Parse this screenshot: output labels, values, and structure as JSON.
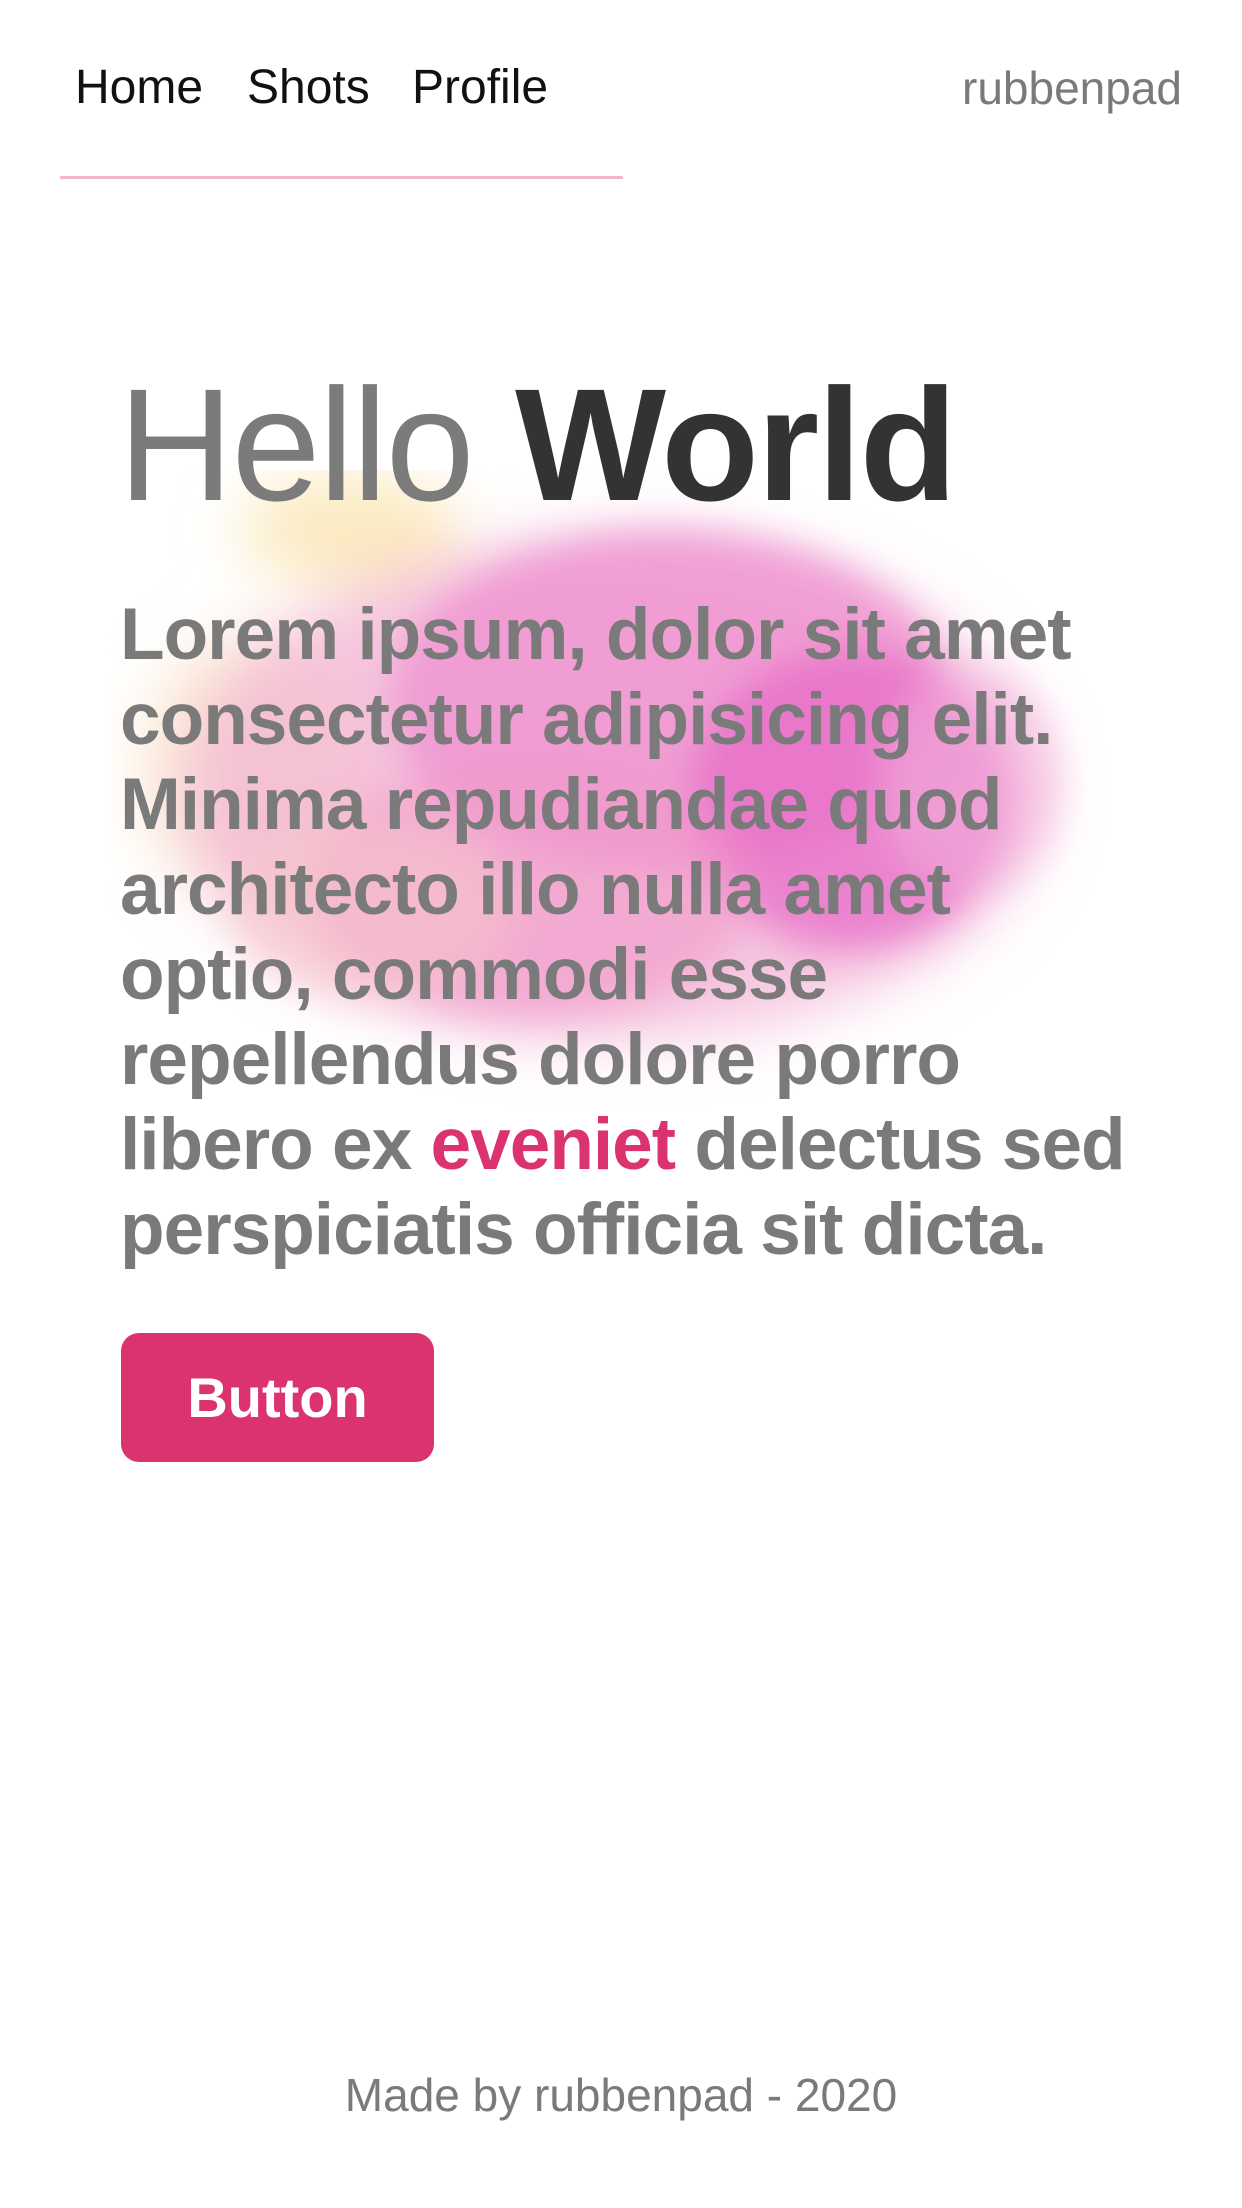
{
  "nav": {
    "links": [
      {
        "label": "Home"
      },
      {
        "label": "Shots"
      },
      {
        "label": "Profile"
      }
    ],
    "username": "rubbenpad",
    "accent_color": "#f0b6c9"
  },
  "hero": {
    "title_light": "Hello",
    "title_bold": "World",
    "paragraph_before": "Lorem ipsum, dolor sit amet consectetur adipisicing elit. Minima repudiandae quod architecto illo nulla amet optio, commodi esse repellendus dolore porro libero ex ",
    "paragraph_highlight": "eveniet",
    "paragraph_after": " delectus sed perspiciatis officia sit dicta.",
    "highlight_color": "#db3370",
    "button_label": "Button",
    "button_color": "#db3370",
    "background_decoration": "watercolor-splash-pink"
  },
  "footer": {
    "text": "Made by rubbenpad - 2020"
  }
}
